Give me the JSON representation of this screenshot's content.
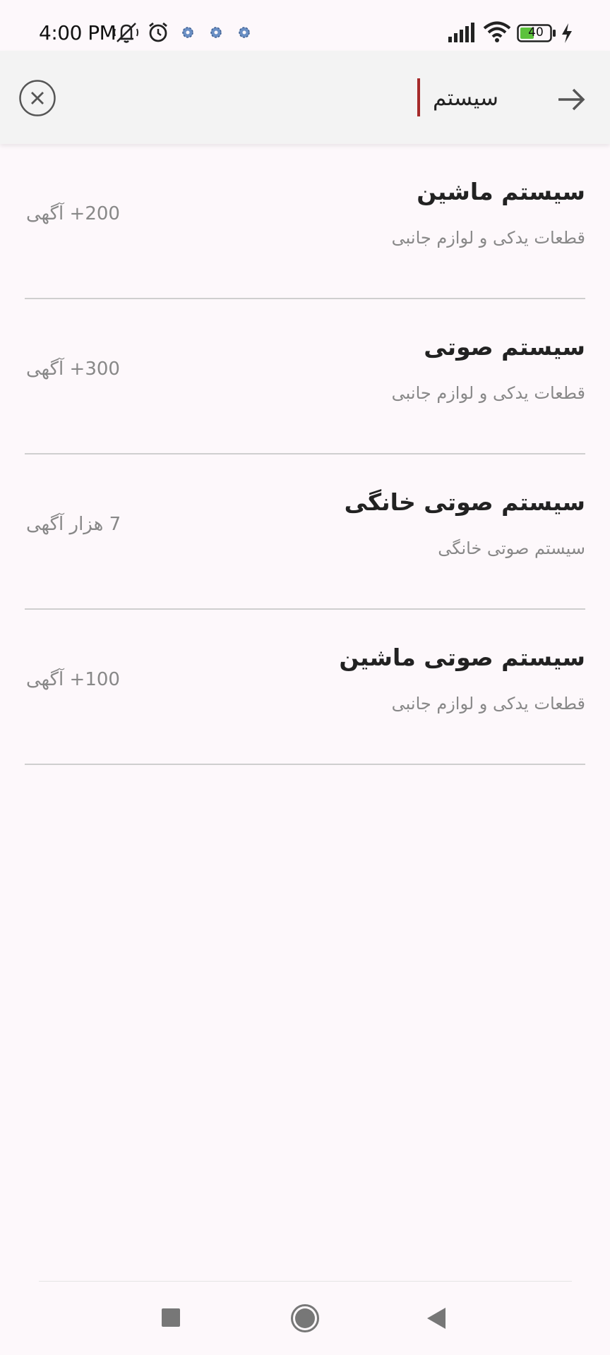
{
  "status_bar": {
    "time": "4:00 PM",
    "battery_level": "40",
    "icons": [
      "muted-bell-icon",
      "alarm-icon",
      "gear-icon",
      "gear-icon",
      "gear-icon",
      "signal-icon",
      "wifi-icon",
      "battery-icon",
      "charging-bolt-icon"
    ]
  },
  "search": {
    "query": "سیستم",
    "caret_color": "#a52a2a"
  },
  "results": [
    {
      "title": "سیستم ماشین",
      "category": "قطعات یدکی و لوازم جانبی",
      "count": "200+ آگهی"
    },
    {
      "title": "سیستم صوتی",
      "category": "قطعات یدکی و لوازم جانبی",
      "count": "300+ آگهی"
    },
    {
      "title": "سیستم صوتی خانگی",
      "category": "سیستم صوتی خانگی",
      "count": "7 هزار آگهی"
    },
    {
      "title": "سیستم صوتی ماشین",
      "category": "قطعات یدکی و لوازم جانبی",
      "count": "100+ آگهی"
    }
  ],
  "nav_bar": {
    "icons": [
      "recents-square-icon",
      "home-circle-icon",
      "back-triangle-icon"
    ]
  }
}
